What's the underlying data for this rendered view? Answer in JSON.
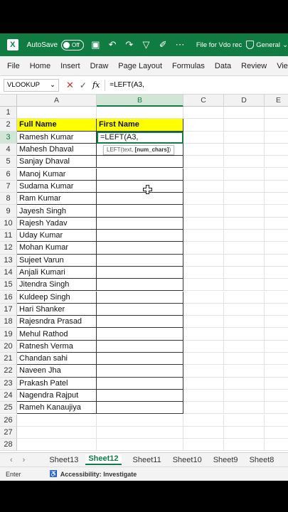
{
  "app": {
    "autosave_label": "AutoSave",
    "autosave_state": "Off",
    "doc_title": "File for Vdo rec",
    "sensitivity": "General",
    "accent": "#107c41"
  },
  "menu": [
    "File",
    "Home",
    "Insert",
    "Draw",
    "Page Layout",
    "Formulas",
    "Data",
    "Review",
    "Vie"
  ],
  "formula_bar": {
    "name_box": "VLOOKUP",
    "content": "=LEFT(A3,"
  },
  "columns": [
    "A",
    "B",
    "C",
    "D",
    "E"
  ],
  "rows": [
    "1",
    "2",
    "3",
    "4",
    "5",
    "6",
    "7",
    "8",
    "9",
    "10",
    "11",
    "12",
    "13",
    "14",
    "15",
    "16",
    "17",
    "18",
    "19",
    "20",
    "21",
    "22",
    "23",
    "24",
    "25",
    "26",
    "27",
    "28"
  ],
  "table": {
    "header_full": "Full Name",
    "header_first": "First Name",
    "active_input": "=LEFT(A3,",
    "names": [
      "Ramesh Kumar",
      "Mahesh Dhaval",
      "Sanjay Dhaval",
      "Manoj Kumar",
      "Sudama Kumar",
      "Ram Kumar",
      "Jayesh Singh",
      "Rajesh Yadav",
      "Uday Kumar",
      "Mohan Kumar",
      "Sujeet Varun",
      "Anjali Kumari",
      "Jitendra Singh",
      "Kuldeep Singh",
      "Hari Shanker",
      "Rajesndra Prasad",
      "Mehul Rathod",
      "Ratnesh Verma",
      "Chandan sahi",
      "Naveen Jha",
      "Prakash Patel",
      "Nagendra Rajput",
      "Rameh Kanaujiya"
    ]
  },
  "tooltip": {
    "prefix": "LEFT(text, ",
    "bold_arg": "[num_chars]",
    "suffix": ")"
  },
  "sheets": {
    "tabs": [
      "Sheet13",
      "Sheet12",
      "Sheet11",
      "Sheet10",
      "Sheet9",
      "Sheet8"
    ],
    "active": "Sheet12"
  },
  "status": {
    "mode": "Enter",
    "accessibility": "Accessibility: Investigate"
  }
}
